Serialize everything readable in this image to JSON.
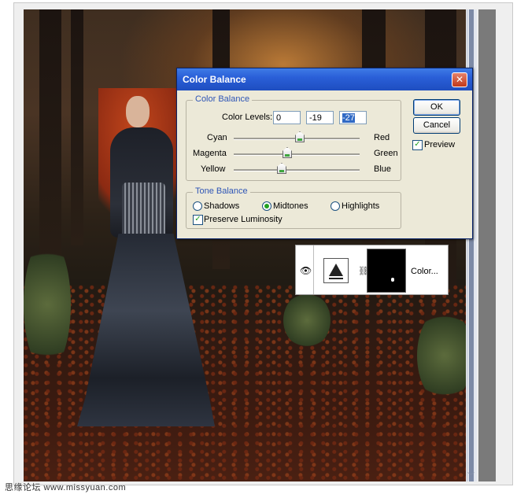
{
  "dialog": {
    "title": "Color Balance",
    "close_label": "✕",
    "color_balance_group": {
      "label": "Color Balance",
      "levels_label": "Color Levels:",
      "levels": [
        "0",
        "-19",
        "-27"
      ],
      "sliders": [
        {
          "left": "Cyan",
          "right": "Red",
          "value": 0
        },
        {
          "left": "Magenta",
          "right": "Green",
          "value": -19
        },
        {
          "left": "Yellow",
          "right": "Blue",
          "value": -27
        }
      ]
    },
    "tone_balance_group": {
      "label": "Tone Balance",
      "options": [
        "Shadows",
        "Midtones",
        "Highlights"
      ],
      "selected": "Midtones",
      "preserve_luminosity_label": "Preserve Luminosity",
      "preserve_luminosity": true
    },
    "ok_label": "OK",
    "cancel_label": "Cancel",
    "preview_label": "Preview",
    "preview_checked": true
  },
  "layer": {
    "name": "Color...",
    "visibility_icon": "eye-icon",
    "link_icon": "chain-link-icon",
    "adjustment_icon": "color-balance-icon"
  },
  "watermark": "思缘论坛   www.missyuan.com",
  "colors": {
    "title_bar": "#2a5fd8",
    "dialog_bg": "#ece9d8",
    "group_label": "#2e55b6",
    "check_mark": "#21a121"
  }
}
